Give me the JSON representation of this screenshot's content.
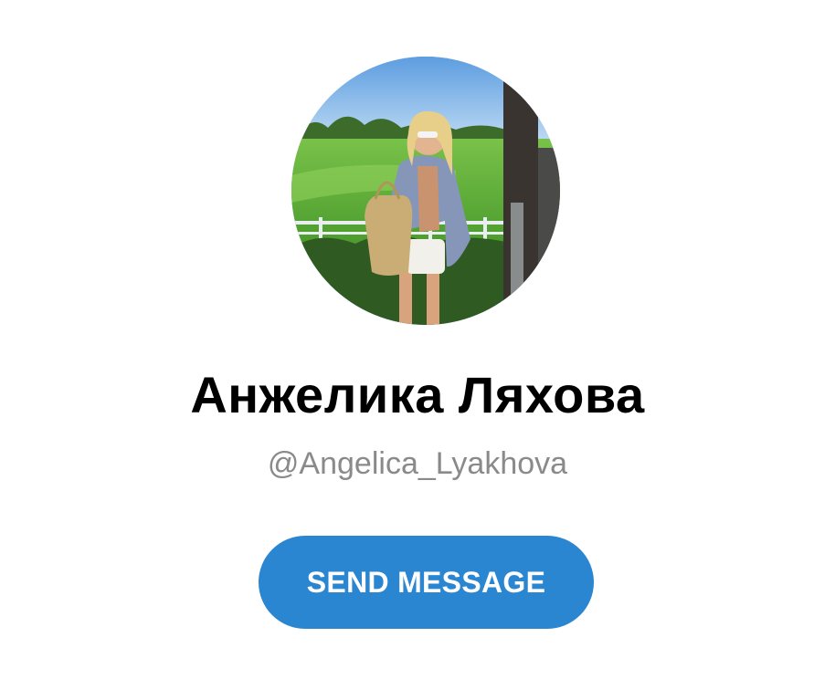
{
  "profile": {
    "name": "Анжелика Ляхова",
    "username": "@Angelica_Lyakhova",
    "send_button_label": "SEND MESSAGE"
  },
  "colors": {
    "button_background": "#2b86d2",
    "button_text": "#ffffff",
    "name_text": "#000000",
    "username_text": "#8a8a8a"
  }
}
